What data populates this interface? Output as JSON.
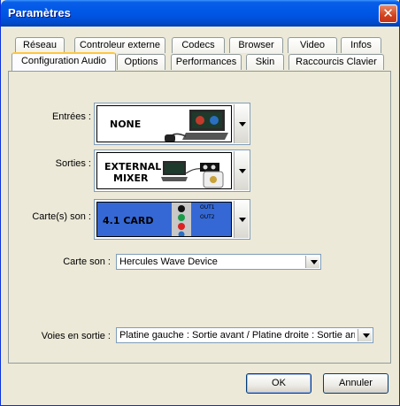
{
  "window": {
    "title": "Paramètres",
    "close_glyph": "✕"
  },
  "tabs_back_row": [
    "Réseau",
    "Controleur externe",
    "Codecs",
    "Browser",
    "Video",
    "Infos"
  ],
  "tabs_front_row": [
    "Configuration Audio",
    "Options",
    "Performances",
    "Skin",
    "Raccourcis Clavier"
  ],
  "active_tab": "Configuration Audio",
  "audio": {
    "inputs_label": "Entrées :",
    "inputs_value": "NONE",
    "outputs_label": "Sorties :",
    "outputs_value_line1": "EXTERNAL",
    "outputs_value_line2": "MIXER",
    "soundcards_label": "Carte(s) son :",
    "soundcards_value": "4.1 CARD",
    "card_out1": "OUT1",
    "card_out2": "OUT2",
    "card_label": "Carte son :",
    "card_value": "Hercules Wave Device",
    "channels_label": "Voies en sortie :",
    "channels_value": "Platine gauche : Sortie avant / Platine droite : Sortie arriè"
  },
  "buttons": {
    "ok": "OK",
    "cancel": "Annuler"
  },
  "colors": {
    "titlebar": "#0054e3",
    "close": "#d2431e",
    "soundcard_bg": "#3568d4",
    "tab_highlight": "#ffc83c"
  }
}
